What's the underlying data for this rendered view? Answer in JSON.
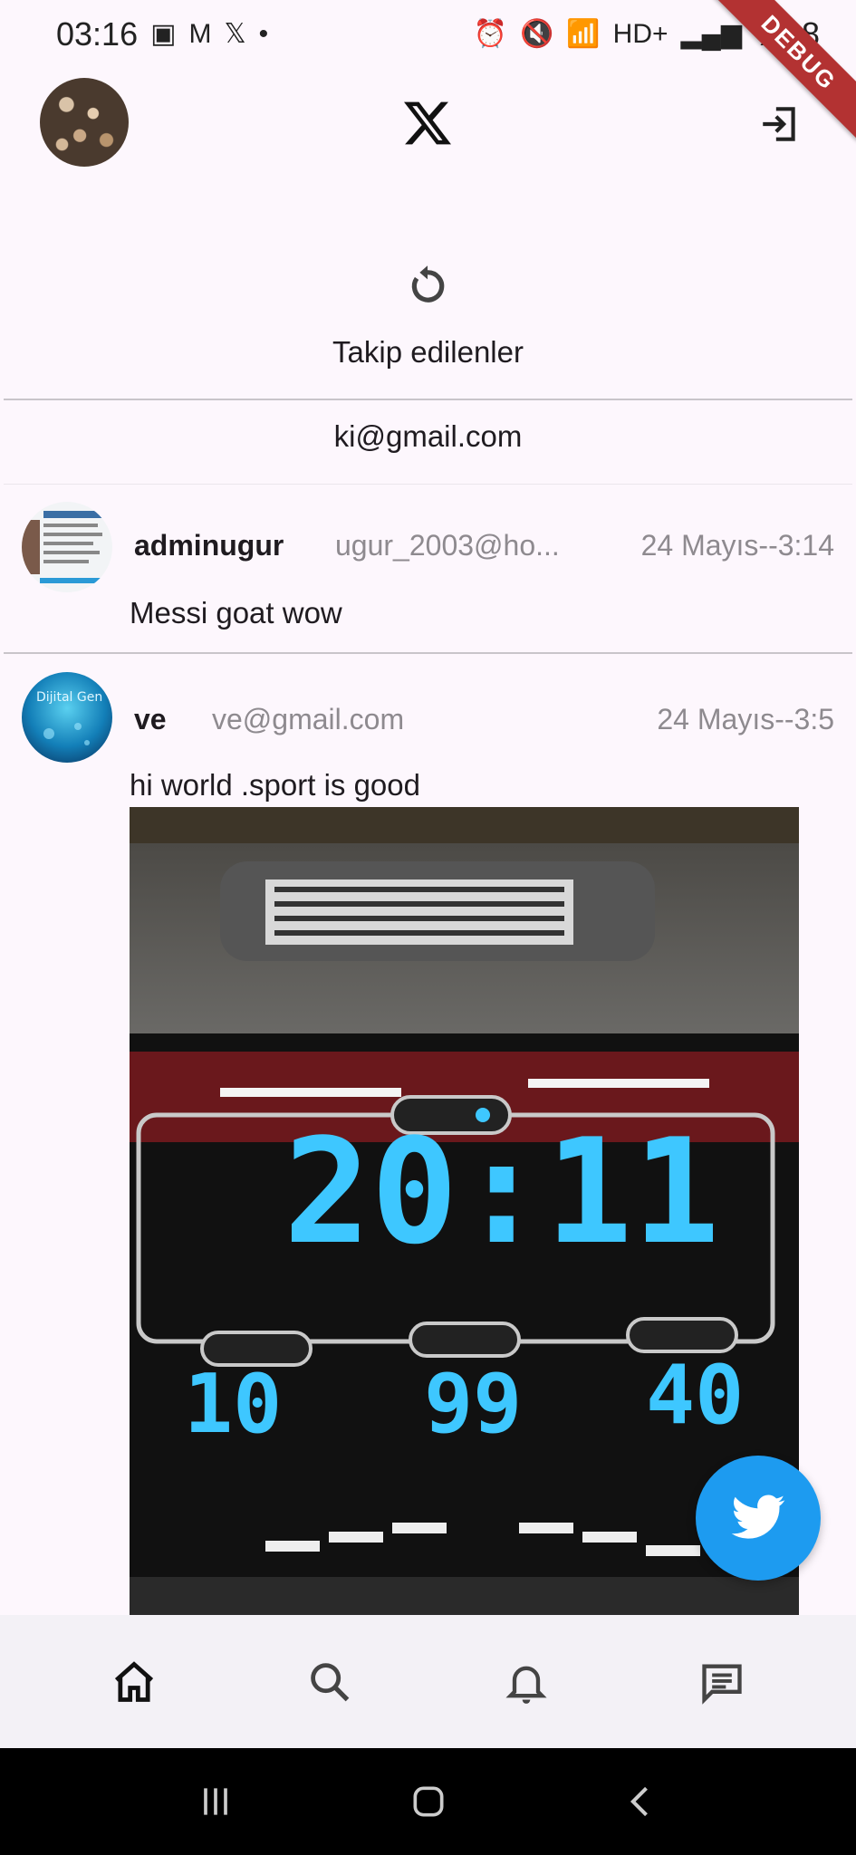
{
  "status_bar": {
    "time": "03:16",
    "battery": "%98"
  },
  "debug_banner": "DEBUG",
  "app_bar": {
    "logo": "x-logo-icon",
    "logout_icon": "logout-icon"
  },
  "feed_header": {
    "tab_label": "Takip edilenler",
    "current_user_email": "ki@gmail.com"
  },
  "posts": [
    {
      "name": "adminugur",
      "handle": "ugur_2003@ho...",
      "time": "24 Mayıs--3:14",
      "text": "Messi goat wow"
    },
    {
      "name": "ve",
      "handle": "ve@gmail.com",
      "time": "24 Mayıs--3:5",
      "text": "hi world .sport is good",
      "image": {
        "display_time": "20:11",
        "stat_left": "10",
        "stat_mid": "99",
        "stat_right": "40"
      }
    }
  ],
  "bottom_nav": [
    "home-icon",
    "search-icon",
    "bell-icon",
    "message-icon"
  ],
  "colors": {
    "accent": "#1d9bf0",
    "background": "#fdf7fd",
    "muted_text": "#8e8a8f"
  }
}
